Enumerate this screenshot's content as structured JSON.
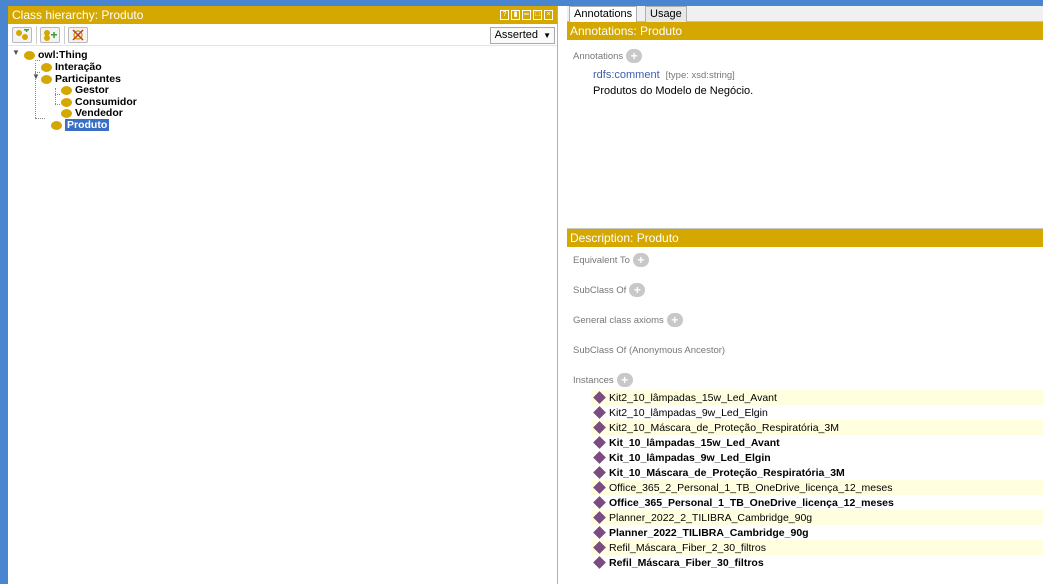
{
  "left": {
    "title": "Class hierarchy: Produto",
    "dropdown": "Asserted",
    "tree": {
      "root": "owl:Thing",
      "interacao": "Interação",
      "participantes": "Participantes",
      "gestor": "Gestor",
      "consumidor": "Consumidor",
      "vendedor": "Vendedor",
      "produto": "Produto"
    }
  },
  "right": {
    "tabs": [
      "Annotations",
      "Usage"
    ],
    "annotations_title": "Annotations: Produto",
    "annotations_label": "Annotations",
    "annotation_property": "rdfs:comment",
    "annotation_type": "[type: xsd:string]",
    "annotation_value": "Produtos do Modelo de Negócio.",
    "description_title": "Description: Produto",
    "sections": {
      "equivalent": "Equivalent To",
      "subclass": "SubClass Of",
      "general": "General class axioms",
      "anonymous": "SubClass Of (Anonymous Ancestor)",
      "instances": "Instances"
    },
    "instances": [
      "Kit2_10_lâmpadas_15w_Led_Avant",
      "Kit2_10_lâmpadas_9w_Led_Elgin",
      "Kit2_10_Máscara_de_Proteção_Respiratória_3M",
      "Kit_10_lâmpadas_15w_Led_Avant",
      "Kit_10_lâmpadas_9w_Led_Elgin",
      "Kit_10_Máscara_de_Proteção_Respiratória_3M",
      "Office_365_2_Personal_1_TB_OneDrive_licença_12_meses",
      "Office_365_Personal_1_TB_OneDrive_licença_12_meses",
      "Planner_2022_2_TILIBRA_Cambridge_90g",
      "Planner_2022_TILIBRA_Cambridge_90g",
      "Refil_Máscara_Fiber_2_30_filtros",
      "Refil_Máscara_Fiber_30_filtros"
    ]
  },
  "colors": {
    "accent": "#d4a800",
    "frame": "#4a86d0",
    "selection": "#3b6fc4",
    "instance": "#7a4c80"
  }
}
